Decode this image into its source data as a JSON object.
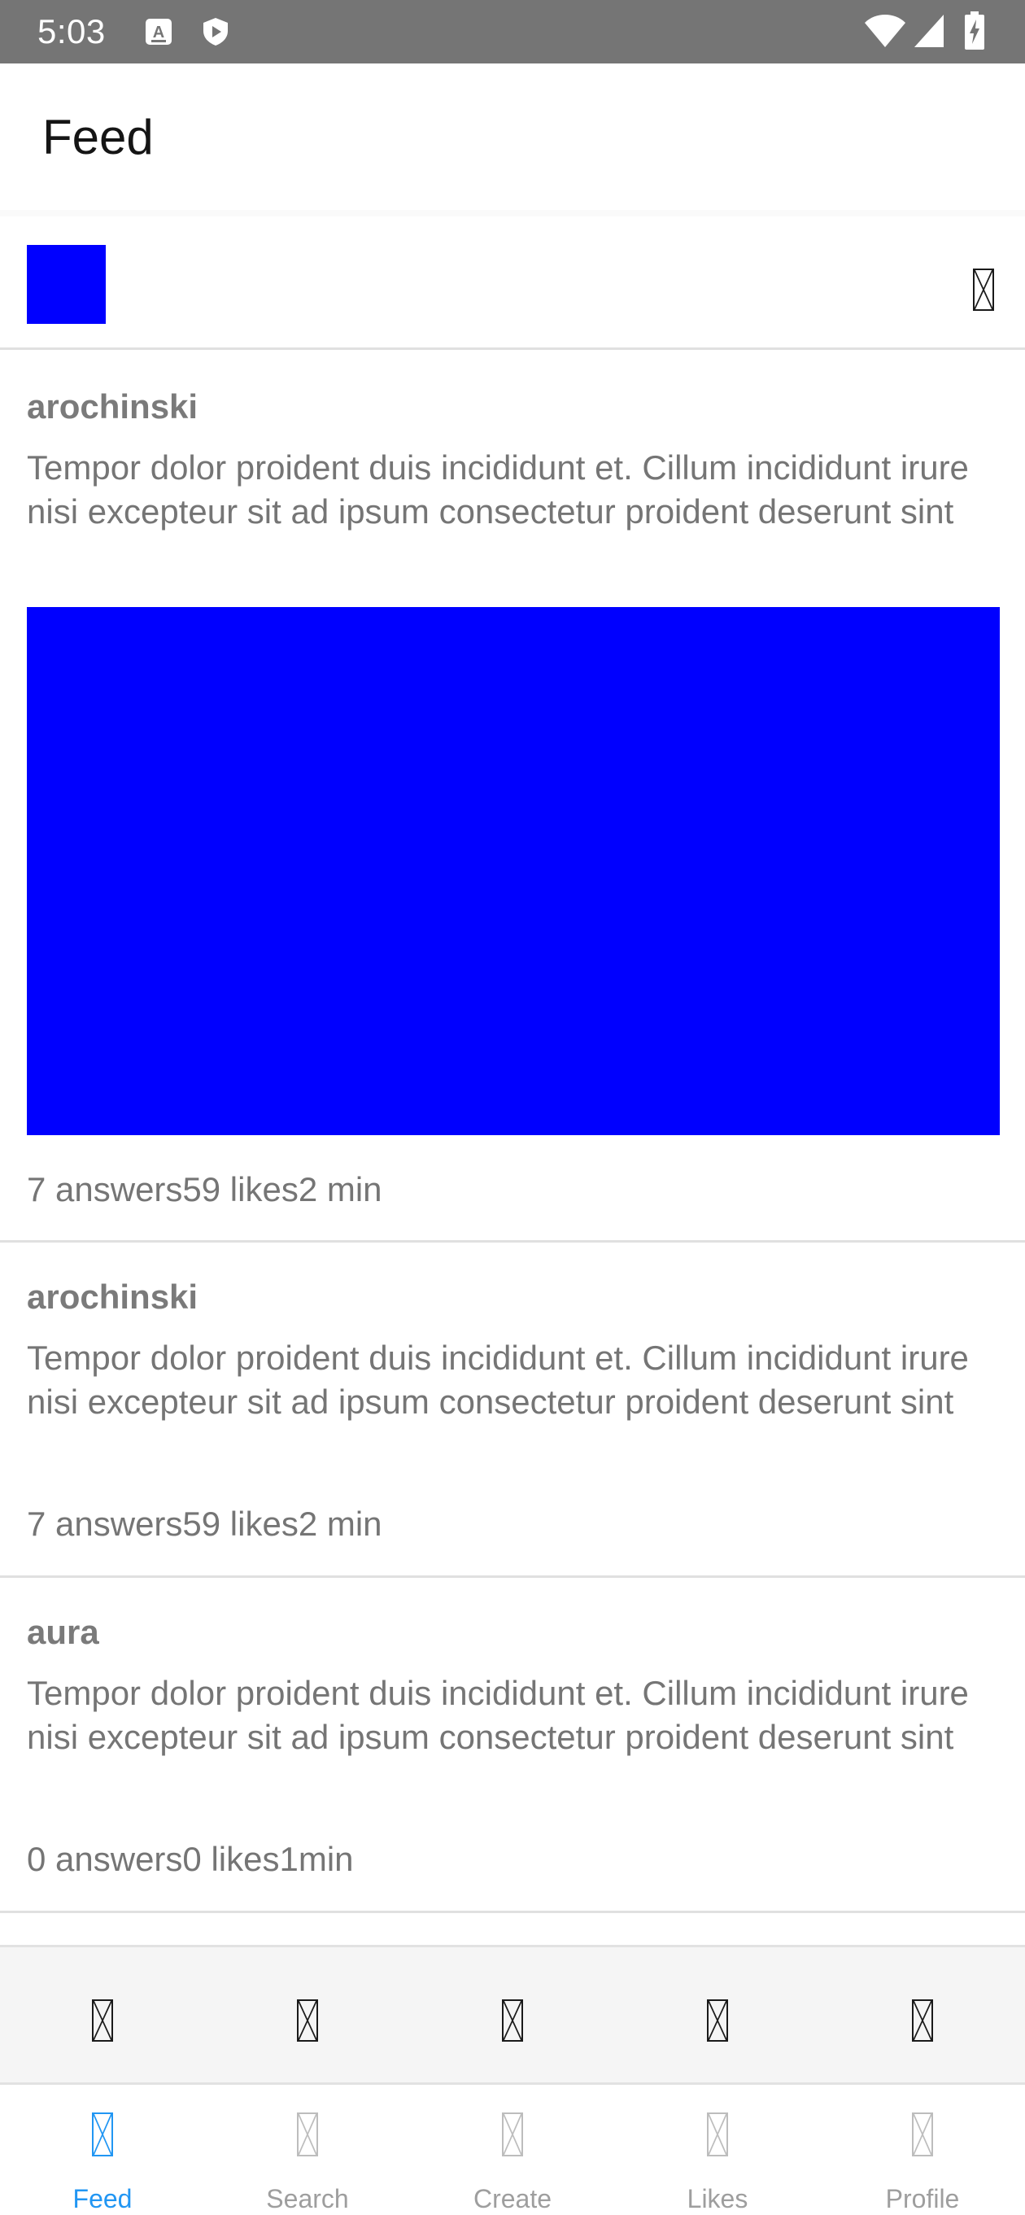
{
  "status_bar": {
    "time": "5:03",
    "left_icons": [
      "accessibility-a-icon",
      "play-protect-icon"
    ],
    "right_icons": [
      "wifi-icon",
      "cell-signal-icon",
      "battery-charging-icon"
    ]
  },
  "app_bar": {
    "title": "Feed"
  },
  "header": {
    "accent_color": "#0000ff",
    "action_icon": "missing-glyph-icon"
  },
  "posts": [
    {
      "author": "arochinski",
      "body": "Tempor dolor proident duis incididunt et. Cillum incididunt irure nisi excepteur sit ad ipsum consectetur proident deserunt sint",
      "has_image": true,
      "image_color": "#0000ff",
      "meta": "7 answers59 likes2 min"
    },
    {
      "author": "arochinski",
      "body": "Tempor dolor proident duis incididunt et. Cillum incididunt irure nisi excepteur sit ad ipsum consectetur proident deserunt sint",
      "has_image": false,
      "meta": "7 answers59 likes2 min"
    },
    {
      "author": "aura",
      "body": "Tempor dolor proident duis incididunt et. Cillum incididunt irure nisi excepteur sit ad ipsum consectetur proident deserunt sint",
      "has_image": false,
      "meta": "0 answers0 likes1min"
    }
  ],
  "icon_row": {
    "icons": [
      "missing-glyph-icon",
      "missing-glyph-icon",
      "missing-glyph-icon",
      "missing-glyph-icon",
      "missing-glyph-icon"
    ]
  },
  "bottom_nav": {
    "active_color": "#2196f3",
    "inactive_color": "#9e9e9e",
    "items": [
      {
        "label": "Feed",
        "active": true
      },
      {
        "label": "Search",
        "active": false
      },
      {
        "label": "Create",
        "active": false
      },
      {
        "label": "Likes",
        "active": false
      },
      {
        "label": "Profile",
        "active": false
      }
    ]
  }
}
